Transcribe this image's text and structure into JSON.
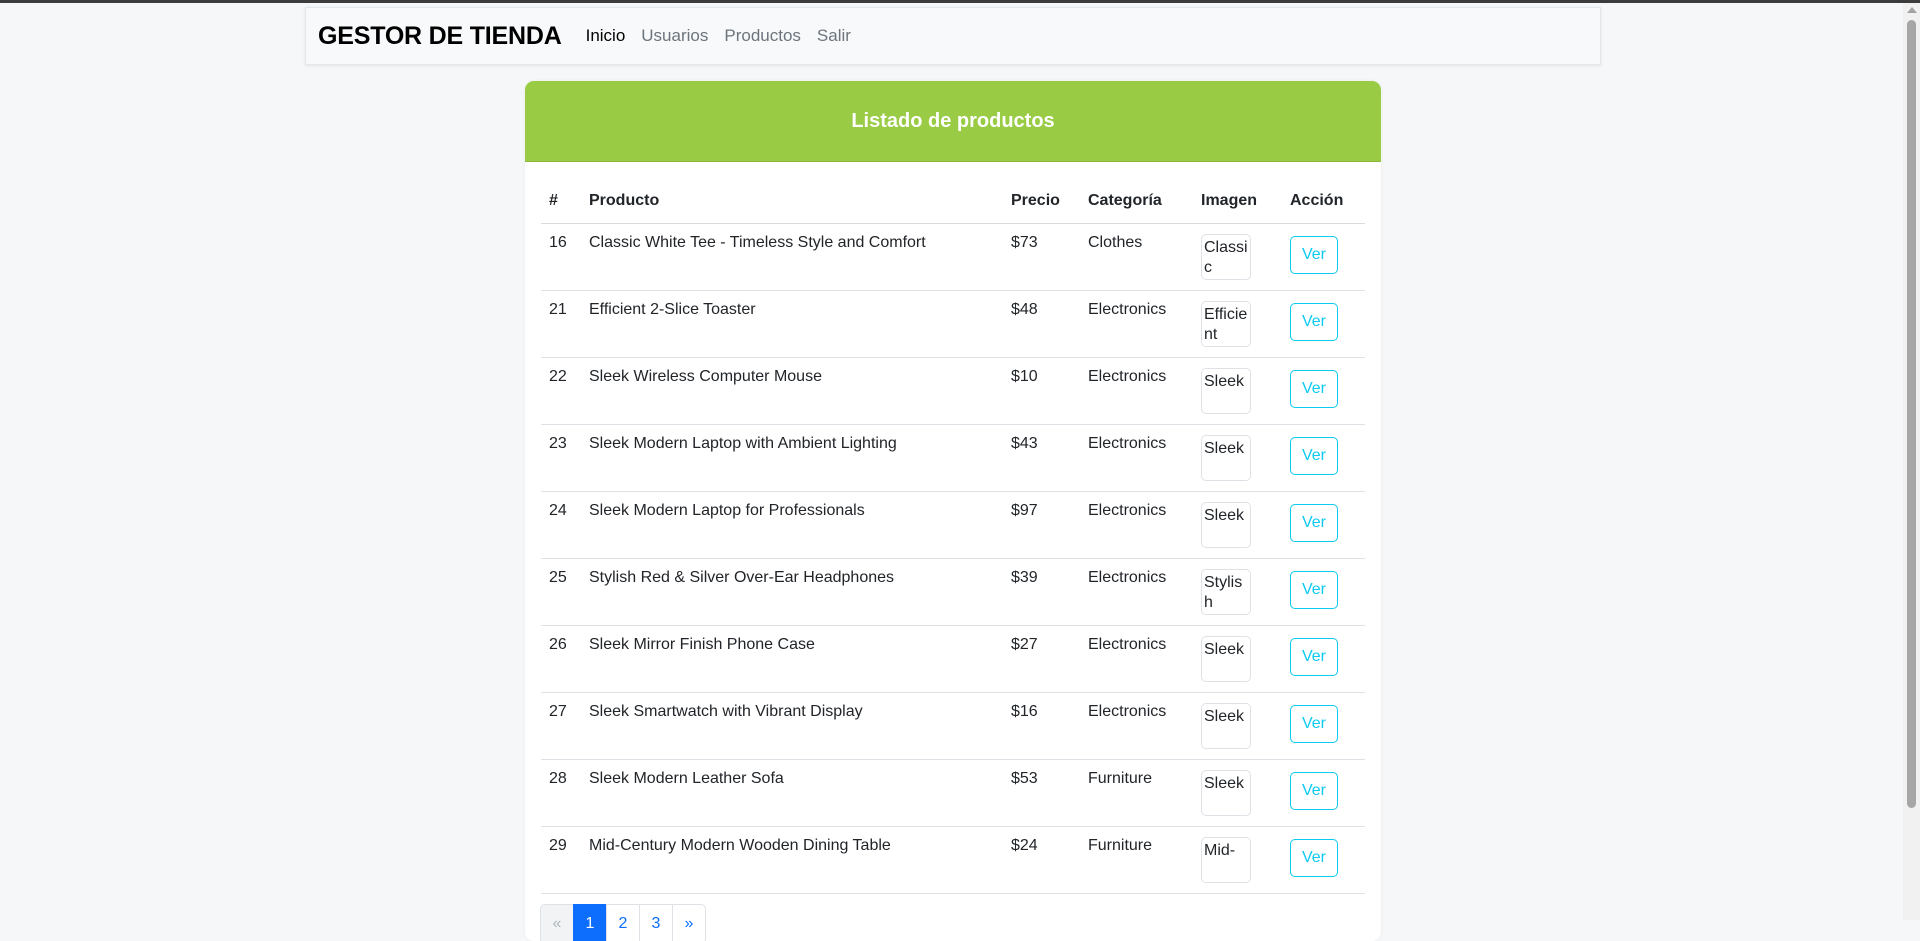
{
  "navbar": {
    "brand": "GESTOR DE TIENDA",
    "links": [
      {
        "label": "Inicio",
        "active": true
      },
      {
        "label": "Usuarios",
        "active": false
      },
      {
        "label": "Productos",
        "active": false
      },
      {
        "label": "Salir",
        "active": false
      }
    ]
  },
  "card": {
    "title": "Listado de productos",
    "header_color": "#99cc44"
  },
  "table": {
    "columns": [
      "#",
      "Producto",
      "Precio",
      "Categoría",
      "Imagen",
      "Acción"
    ],
    "rows": [
      {
        "id": "16",
        "product": "Classic White Tee - Timeless Style and Comfort",
        "price": "$73",
        "category": "Clothes",
        "image_alt": "Classic",
        "action": "Ver"
      },
      {
        "id": "21",
        "product": "Efficient 2-Slice Toaster",
        "price": "$48",
        "category": "Electronics",
        "image_alt": "Efficient",
        "action": "Ver"
      },
      {
        "id": "22",
        "product": "Sleek Wireless Computer Mouse",
        "price": "$10",
        "category": "Electronics",
        "image_alt": "Sleek",
        "action": "Ver"
      },
      {
        "id": "23",
        "product": "Sleek Modern Laptop with Ambient Lighting",
        "price": "$43",
        "category": "Electronics",
        "image_alt": "Sleek",
        "action": "Ver"
      },
      {
        "id": "24",
        "product": "Sleek Modern Laptop for Professionals",
        "price": "$97",
        "category": "Electronics",
        "image_alt": "Sleek",
        "action": "Ver"
      },
      {
        "id": "25",
        "product": "Stylish Red & Silver Over-Ear Headphones",
        "price": "$39",
        "category": "Electronics",
        "image_alt": "Stylish",
        "action": "Ver"
      },
      {
        "id": "26",
        "product": "Sleek Mirror Finish Phone Case",
        "price": "$27",
        "category": "Electronics",
        "image_alt": "Sleek",
        "action": "Ver"
      },
      {
        "id": "27",
        "product": "Sleek Smartwatch with Vibrant Display",
        "price": "$16",
        "category": "Electronics",
        "image_alt": "Sleek",
        "action": "Ver"
      },
      {
        "id": "28",
        "product": "Sleek Modern Leather Sofa",
        "price": "$53",
        "category": "Furniture",
        "image_alt": "Sleek",
        "action": "Ver"
      },
      {
        "id": "29",
        "product": "Mid-Century Modern Wooden Dining Table",
        "price": "$24",
        "category": "Furniture",
        "image_alt": "Mid-",
        "action": "Ver"
      }
    ]
  },
  "pagination": {
    "items": [
      {
        "label": "«",
        "active": false
      },
      {
        "label": "1",
        "active": true
      },
      {
        "label": "2",
        "active": false
      },
      {
        "label": "3",
        "active": false
      },
      {
        "label": "»",
        "active": false
      }
    ]
  },
  "colors": {
    "accent": "#99cc44",
    "info_button": "#0dcaf0",
    "page_active": "#0d6efd"
  }
}
